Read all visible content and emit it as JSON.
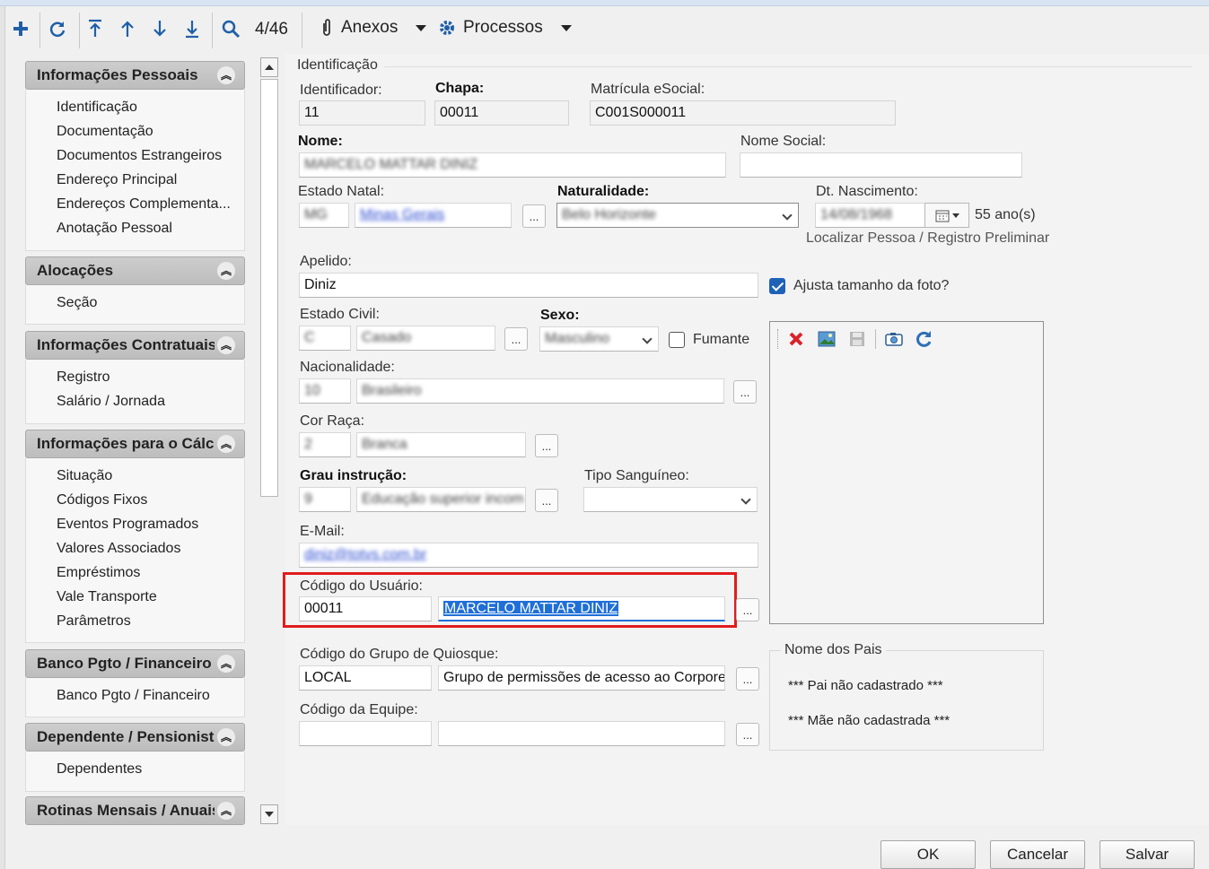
{
  "toolbar": {
    "page_counter": "4/46",
    "anexos_label": "Anexos",
    "processos_label": "Processos"
  },
  "nav": {
    "groups": [
      {
        "title": "Informações Pessoais",
        "items": [
          "Identificação",
          "Documentação",
          "Documentos Estrangeiros",
          "Endereço Principal",
          "Endereços Complementa...",
          "Anotação Pessoal"
        ]
      },
      {
        "title": "Alocações",
        "items": [
          "Seção"
        ]
      },
      {
        "title": "Informações Contratuais",
        "items": [
          "Registro",
          "Salário / Jornada"
        ]
      },
      {
        "title": "Informações para o Cálculo",
        "items": [
          "Situação",
          "Códigos Fixos",
          "Eventos Programados",
          "Valores Associados",
          "Empréstimos",
          "Vale Transporte",
          "Parâmetros"
        ]
      },
      {
        "title": "Banco Pgto / Financeiro",
        "items": [
          "Banco Pgto / Financeiro"
        ]
      },
      {
        "title": "Dependente / Pensionista",
        "items": [
          "Dependentes"
        ]
      },
      {
        "title": "Rotinas Mensais / Anuais",
        "items": []
      }
    ]
  },
  "form": {
    "section_title": "Identificação",
    "identificador": {
      "label": "Identificador:",
      "value": "11"
    },
    "chapa": {
      "label": "Chapa:",
      "value": "00011"
    },
    "matricula": {
      "label": "Matrícula eSocial:",
      "value": "C001S000011"
    },
    "nome": {
      "label": "Nome:",
      "value": "MARCELO MATTAR DINIZ"
    },
    "nome_social": {
      "label": "Nome Social:",
      "value": ""
    },
    "estado_natal": {
      "label": "Estado Natal:",
      "uf": "MG",
      "desc": "Minas Gerais"
    },
    "naturalidade": {
      "label": "Naturalidade:",
      "value": "Belo Horizonte"
    },
    "dt_nascimento": {
      "label": "Dt. Nascimento:",
      "value": "14/08/1968",
      "age": "55 ano(s)"
    },
    "localizar_link": "Localizar Pessoa / Registro Preliminar",
    "apelido": {
      "label": "Apelido:",
      "value": "Diniz"
    },
    "ajusta_foto": {
      "label": "Ajusta tamanho da foto?",
      "checked": true
    },
    "estado_civil": {
      "label": "Estado Civil:",
      "code": "C",
      "desc": "Casado"
    },
    "sexo": {
      "label": "Sexo:",
      "value": "Masculino"
    },
    "fumante": {
      "label": "Fumante",
      "checked": false
    },
    "nacionalidade": {
      "label": "Nacionalidade:",
      "code": "10",
      "desc": "Brasileiro"
    },
    "cor_raca": {
      "label": "Cor Raça:",
      "code": "2",
      "desc": "Branca"
    },
    "grau_instrucao": {
      "label": "Grau instrução:",
      "code": "9",
      "desc": "Educação superior incom"
    },
    "tipo_sanguineo": {
      "label": "Tipo Sanguíneo:",
      "value": ""
    },
    "email": {
      "label": "E-Mail:",
      "value": "diniz@totvs.com.br"
    },
    "codigo_usuario": {
      "label": "Código do Usuário:",
      "code": "00011",
      "name": "MARCELO MATTAR DINIZ"
    },
    "grupo_quiosque": {
      "label": "Código do Grupo de Quiosque:",
      "code": "LOCAL",
      "desc": "Grupo de permissões de acesso ao Corporel"
    },
    "equipe": {
      "label": "Código da Equipe:",
      "code": "",
      "desc": ""
    },
    "pais": {
      "title": "Nome dos Pais",
      "pai": "*** Pai não cadastrado ***",
      "mae": "*** Mãe não cadastrada ***"
    }
  },
  "buttons": {
    "ok": "OK",
    "cancelar": "Cancelar",
    "salvar": "Salvar"
  },
  "colors": {
    "accent": "#1f5fa8",
    "highlight_border": "#e11c1c",
    "selection": "#1f6fd6"
  }
}
